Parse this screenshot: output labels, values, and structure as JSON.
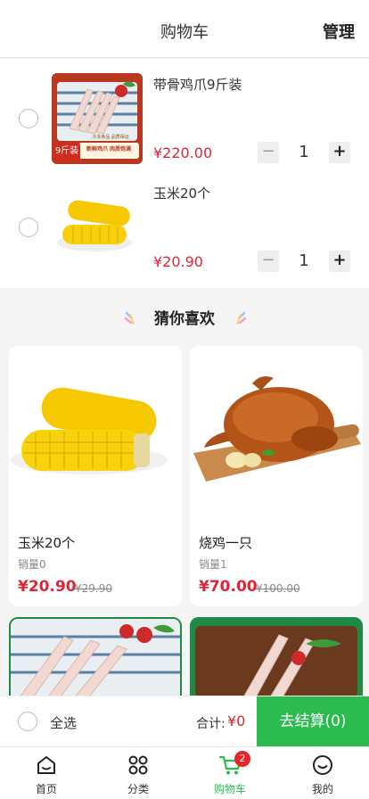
{
  "header": {
    "title": "购物车",
    "manage": "管理"
  },
  "cart": {
    "items": [
      {
        "name": "带骨鸡爪9斤装",
        "price": "¥220.00",
        "qty": "1",
        "badge": "9斤装",
        "banner": "新鲜鸡爪 肉质饱满",
        "strip": "冷冻食品 品质保证"
      },
      {
        "name": "玉米20个",
        "price": "¥20.90",
        "qty": "1"
      }
    ]
  },
  "guess": {
    "title": "猜你喜欢"
  },
  "products": [
    {
      "name": "玉米20个",
      "sold": "销量0",
      "price": "¥20.90",
      "old_price": "¥29.90"
    },
    {
      "name": "烧鸡一只",
      "sold": "销量1",
      "price": "¥70.00",
      "old_price": "¥100.00"
    }
  ],
  "checkout": {
    "select_all": "全选",
    "total_label": "合计:",
    "total_value": "¥0",
    "button": "去结算(0)"
  },
  "tabbar": {
    "items": [
      {
        "label": "首页",
        "icon": "home-icon"
      },
      {
        "label": "分类",
        "icon": "category-icon"
      },
      {
        "label": "购物车",
        "icon": "cart-icon",
        "badge": "2",
        "active": true
      },
      {
        "label": "我的",
        "icon": "profile-icon"
      }
    ]
  },
  "colors": {
    "accent_green": "#2bbb4f",
    "price_red": "#e0243a",
    "badge_red": "#e8242b"
  }
}
